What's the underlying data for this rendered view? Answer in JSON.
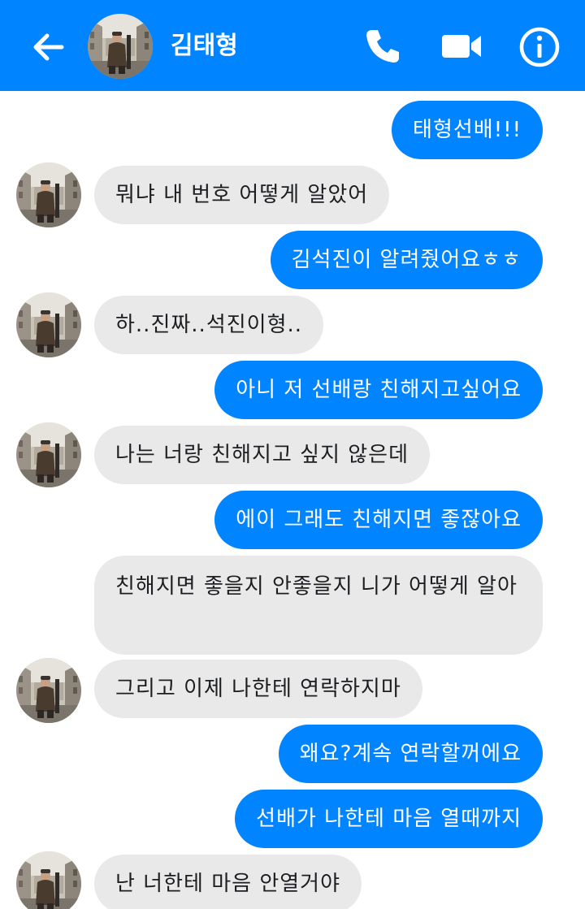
{
  "header": {
    "contact_name": "김태형",
    "icons": {
      "back": "arrow-left-icon",
      "call": "phone-icon",
      "video": "video-camera-icon",
      "info": "info-icon"
    },
    "bg_color": "#0084ff"
  },
  "messages": [
    {
      "side": "out",
      "text": "태형선배!!!"
    },
    {
      "side": "in",
      "text": "뭐냐 내 번호 어떻게 알았어"
    },
    {
      "side": "out",
      "text": "김석진이 알려줬어요ㅎㅎ"
    },
    {
      "side": "in",
      "text": "하..진짜..석진이형.."
    },
    {
      "side": "out",
      "text": "아니 저 선배랑 친해지고싶어요"
    },
    {
      "side": "in",
      "text": "나는 너랑 친해지고 싶지 않은데"
    },
    {
      "side": "out",
      "text": "에이 그래도 친해지면 좋잖아요"
    },
    {
      "side": "in",
      "text": "친해지면 좋을지 안좋을지 니가 어떻게 알아"
    },
    {
      "side": "in",
      "text": "그리고 이제 나한테 연락하지마"
    },
    {
      "side": "out",
      "text": "왜요?계속 연락할꺼에요"
    },
    {
      "side": "out",
      "text": "선배가 나한테 마음 열때까지"
    },
    {
      "side": "in",
      "text": "난 너한테 마음 안열거야"
    }
  ],
  "colors": {
    "outgoing_bubble": "#0084ff",
    "incoming_bubble": "#e9e9e9"
  }
}
